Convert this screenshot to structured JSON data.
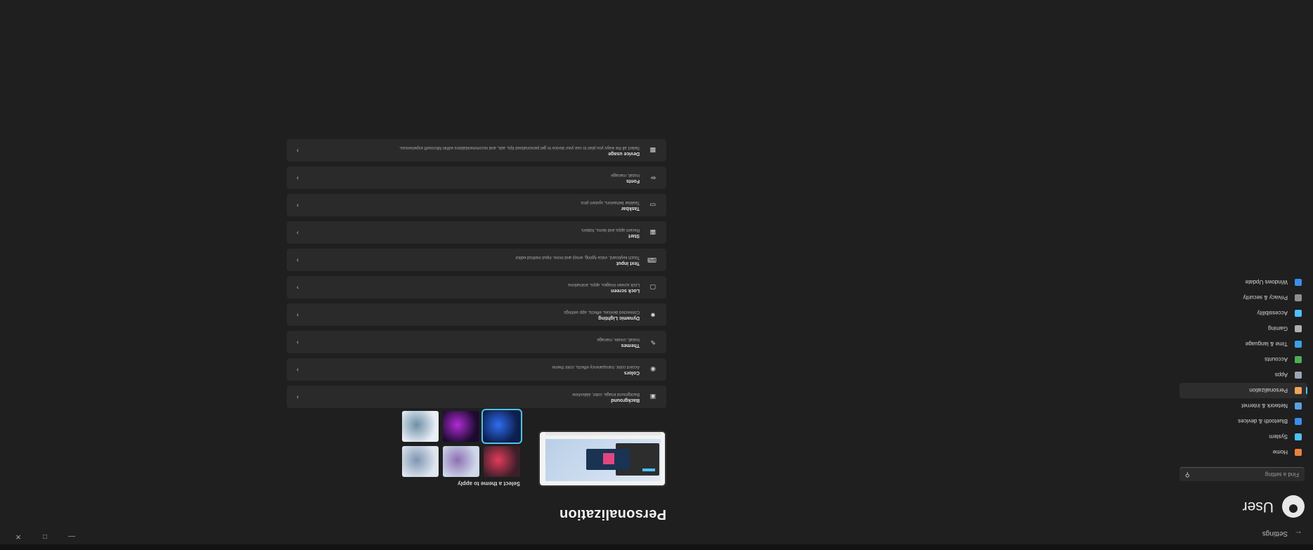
{
  "window": {
    "title": "Settings"
  },
  "sidebar": {
    "user_name": "User",
    "search_placeholder": "Find a setting",
    "items": [
      {
        "label": "Home",
        "icon": "home-icon",
        "color": "#e8833a"
      },
      {
        "label": "System",
        "icon": "system-icon",
        "color": "#4cc2ff"
      },
      {
        "label": "Bluetooth & devices",
        "icon": "bluetooth-icon",
        "color": "#3b8eea"
      },
      {
        "label": "Network & internet",
        "icon": "network-icon",
        "color": "#5aa0e0"
      },
      {
        "label": "Personalization",
        "icon": "brush-icon",
        "color": "#f0a45a",
        "active": true
      },
      {
        "label": "Apps",
        "icon": "apps-icon",
        "color": "#9aa8b8"
      },
      {
        "label": "Accounts",
        "icon": "accounts-icon",
        "color": "#4caf50"
      },
      {
        "label": "Time & language",
        "icon": "globe-icon",
        "color": "#3aa0e8"
      },
      {
        "label": "Gaming",
        "icon": "gamepad-icon",
        "color": "#b0b0b0"
      },
      {
        "label": "Accessibility",
        "icon": "accessibility-icon",
        "color": "#4cc2ff"
      },
      {
        "label": "Privacy & security",
        "icon": "shield-icon",
        "color": "#8e8e8e"
      },
      {
        "label": "Windows Update",
        "icon": "update-icon",
        "color": "#3b8eea"
      }
    ]
  },
  "main": {
    "title": "Personalization",
    "themes_label": "Select a theme to apply",
    "themes": [
      {
        "name": "theme-1",
        "color_a": "#3c1f2a",
        "color_b": "#e23b5a"
      },
      {
        "name": "theme-2",
        "color_a": "#cfd9ea",
        "color_b": "#8d6fb3"
      },
      {
        "name": "theme-3",
        "color_a": "#dfe6ee",
        "color_b": "#7e95b3"
      },
      {
        "name": "theme-4",
        "color_a": "#0c1f4e",
        "color_b": "#2f6df0"
      },
      {
        "name": "theme-5",
        "color_a": "#1b0b2e",
        "color_b": "#b12bd6"
      },
      {
        "name": "theme-6",
        "color_a": "#e7eef5",
        "color_b": "#6e8fa6"
      }
    ],
    "cards": [
      {
        "title": "Background",
        "desc": "Background image, color, slideshow",
        "icon": "image-icon"
      },
      {
        "title": "Colors",
        "desc": "Accent color, transparency effects, color theme",
        "icon": "palette-icon"
      },
      {
        "title": "Themes",
        "desc": "Install, create, manage",
        "icon": "brush-icon"
      },
      {
        "title": "Dynamic Lighting",
        "desc": "Connected devices, effects, app settings",
        "icon": "lighting-icon"
      },
      {
        "title": "Lock screen",
        "desc": "Lock screen images, apps, animations",
        "icon": "lock-screen-icon"
      },
      {
        "title": "Text input",
        "desc": "Touch keyboard, voice typing, emoji and more, input method editor",
        "icon": "keyboard-icon"
      },
      {
        "title": "Start",
        "desc": "Recent apps and items, folders",
        "icon": "start-icon"
      },
      {
        "title": "Taskbar",
        "desc": "Taskbar behaviors, system pins",
        "icon": "taskbar-icon"
      },
      {
        "title": "Fonts",
        "desc": "Install, manage",
        "icon": "font-icon"
      },
      {
        "title": "Device usage",
        "desc": "Select all the ways you plan to use your device to get personalized tips, ads, and recommendations within Microsoft experiences.",
        "icon": "device-usage-icon"
      }
    ]
  }
}
